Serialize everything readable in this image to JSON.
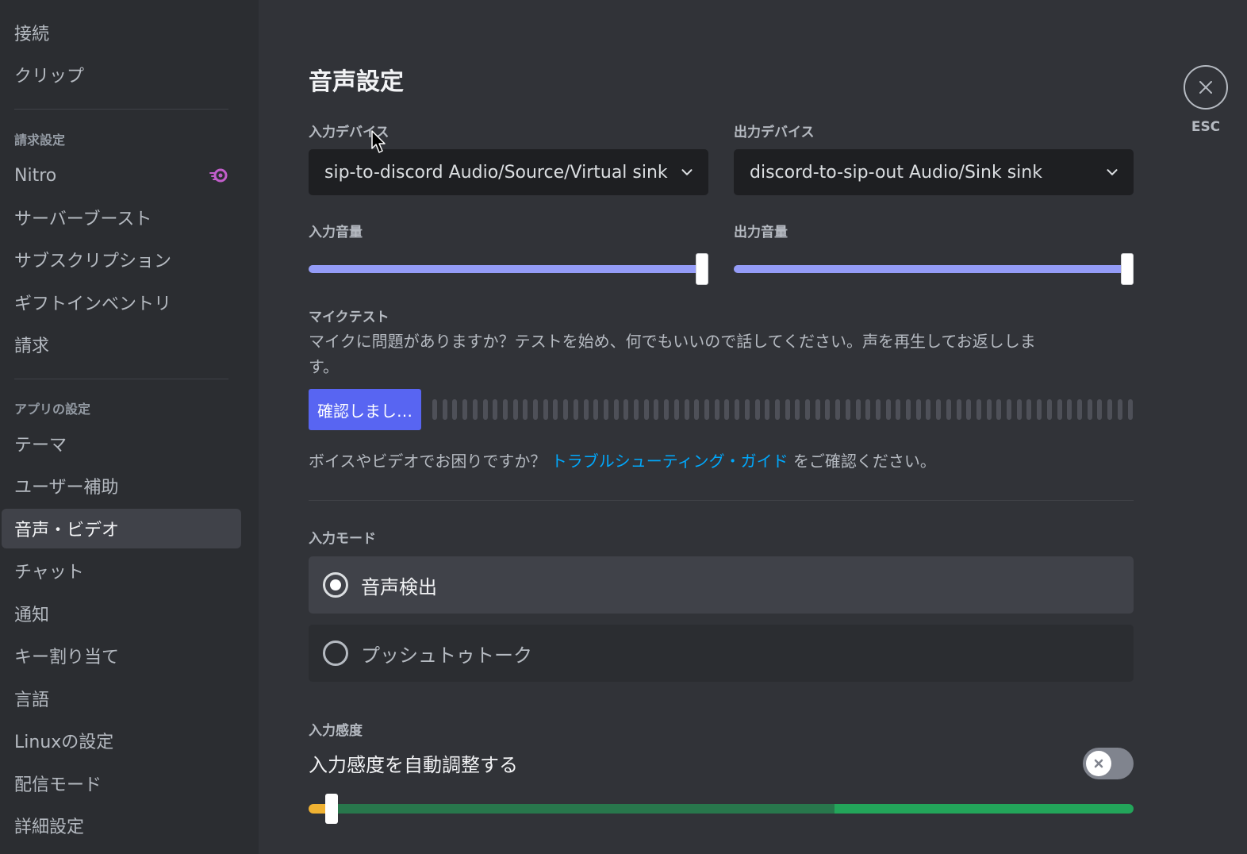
{
  "sidebar": {
    "items_top": [
      {
        "label": "接続"
      },
      {
        "label": "クリップ"
      }
    ],
    "billing_header": "請求設定",
    "billing_items": [
      {
        "label": "Nitro"
      },
      {
        "label": "サーバーブースト"
      },
      {
        "label": "サブスクリプション"
      },
      {
        "label": "ギフトインベントリ"
      },
      {
        "label": "請求"
      }
    ],
    "app_header": "アプリの設定",
    "app_items": [
      {
        "label": "テーマ"
      },
      {
        "label": "ユーザー補助"
      },
      {
        "label": "音声・ビデオ"
      },
      {
        "label": "チャット"
      },
      {
        "label": "通知"
      },
      {
        "label": "キー割り当て"
      },
      {
        "label": "言語"
      },
      {
        "label": "Linuxの設定"
      },
      {
        "label": "配信モード"
      },
      {
        "label": "詳細設定"
      }
    ]
  },
  "main": {
    "title": "音声設定",
    "input_device_label": "入力デバイス",
    "input_device_value": "sip-to-discord Audio/Source/Virtual sink",
    "output_device_label": "出力デバイス",
    "output_device_value": "discord-to-sip-out Audio/Sink sink",
    "input_volume_label": "入力音量",
    "input_volume": 1.0,
    "output_volume_label": "出力音量",
    "output_volume": 1.0,
    "mic_test_label": "マイクテスト",
    "mic_test_desc_1": "マイクに問題がありますか？テストを始め、何でもいいので話してください。声を再生してお返ししま",
    "mic_test_desc_2": "す。",
    "mic_test_button": "確認しまし…",
    "help_prefix": "ボイスやビデオでお困りですか？",
    "help_link": "トラブルシューティング・ガイド",
    "help_suffix": "をご確認ください。",
    "input_mode_label": "入力モード",
    "mode_voice": "音声検出",
    "mode_ptt": "プッシュトゥトーク",
    "sensitivity_label": "入力感度",
    "auto_sensitivity_label": "入力感度を自動調整する",
    "auto_sensitivity_enabled": false,
    "sensitivity_level": 0.02,
    "esc_label": "ESC"
  },
  "colors": {
    "accent": "#5865f2",
    "slider": "#949cf7",
    "link": "#00a8fc",
    "green": "#23a55a",
    "yellow": "#f0b232"
  }
}
